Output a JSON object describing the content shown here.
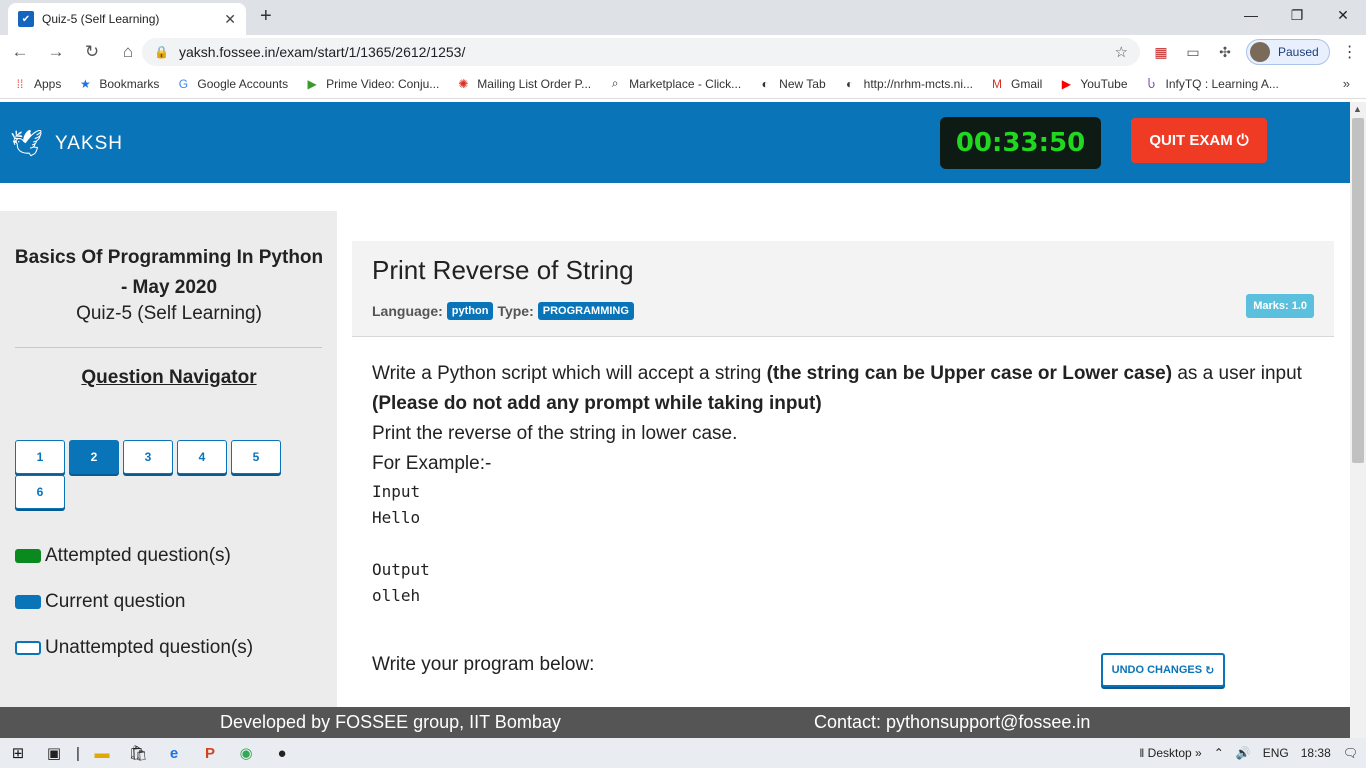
{
  "browser": {
    "tab_title": "Quiz-5 (Self Learning)",
    "url": "yaksh.fossee.in/exam/start/1/1365/2612/1253/",
    "profile_label": "Paused",
    "bookmarks": [
      {
        "label": "Apps",
        "icon": "apps-grid-icon",
        "color": "#e94235"
      },
      {
        "label": "Bookmarks",
        "icon": "star-icon",
        "color": "#1a73e8"
      },
      {
        "label": "Google Accounts",
        "icon": "google-icon",
        "color": "#4285f4"
      },
      {
        "label": "Prime Video: Conju...",
        "icon": "play-icon",
        "color": "#3a9a2a"
      },
      {
        "label": "Mailing List Order P...",
        "icon": "target-icon",
        "color": "#d93025"
      },
      {
        "label": "Marketplace - Click...",
        "icon": "search-doc-icon",
        "color": "#333333"
      },
      {
        "label": "New Tab",
        "icon": "globe-icon",
        "color": "#333333"
      },
      {
        "label": "http://nrhm-mcts.ni...",
        "icon": "globe-icon",
        "color": "#333333"
      },
      {
        "label": "Gmail",
        "icon": "gmail-icon",
        "color": "#d93025"
      },
      {
        "label": "YouTube",
        "icon": "youtube-icon",
        "color": "#ff0000"
      },
      {
        "label": "InfyTQ : Learning A...",
        "icon": "infytq-icon",
        "color": "#7b3fb8"
      }
    ]
  },
  "header": {
    "logo_text": "YAKSH",
    "timer": "00:33:50",
    "quit_label": "QUIT EXAM"
  },
  "sidebar": {
    "course_title": "Basics Of Programming In Python - May 2020",
    "quiz_name": "Quiz-5 (Self Learning)",
    "navigator_heading": "Question Navigator",
    "questions": [
      "1",
      "2",
      "3",
      "4",
      "5",
      "6"
    ],
    "current_question": "2",
    "legend": {
      "attempted": "Attempted question(s)",
      "current": "Current question",
      "unattempted": "Unattempted question(s)"
    }
  },
  "question": {
    "title": "Print Reverse of String",
    "language_label": "Language:",
    "language": "python",
    "type_label": "Type:",
    "type": "PROGRAMMING",
    "marks": "Marks: 1.0",
    "desc_part1": "Write a Python script which will accept a string ",
    "desc_bold": "(the string can be Upper case or Lower case)",
    "desc_part2": " as a user input",
    "desc_note": "(Please do not add any prompt while taking input)",
    "desc_line3": "Print the reverse of the string in lower case.",
    "example_label": "For Example:-",
    "example_input_label": "Input",
    "example_input": "Hello",
    "example_output_label": "Output",
    "example_output": "olleh",
    "write_label": "Write your program below:",
    "undo_label": "UNDO CHANGES"
  },
  "footer": {
    "left": "Developed by FOSSEE group, IIT Bombay",
    "right": "Contact: pythonsupport@fossee.in"
  },
  "taskbar": {
    "desktop_label": "Desktop",
    "lang": "ENG",
    "time": "18:38"
  }
}
